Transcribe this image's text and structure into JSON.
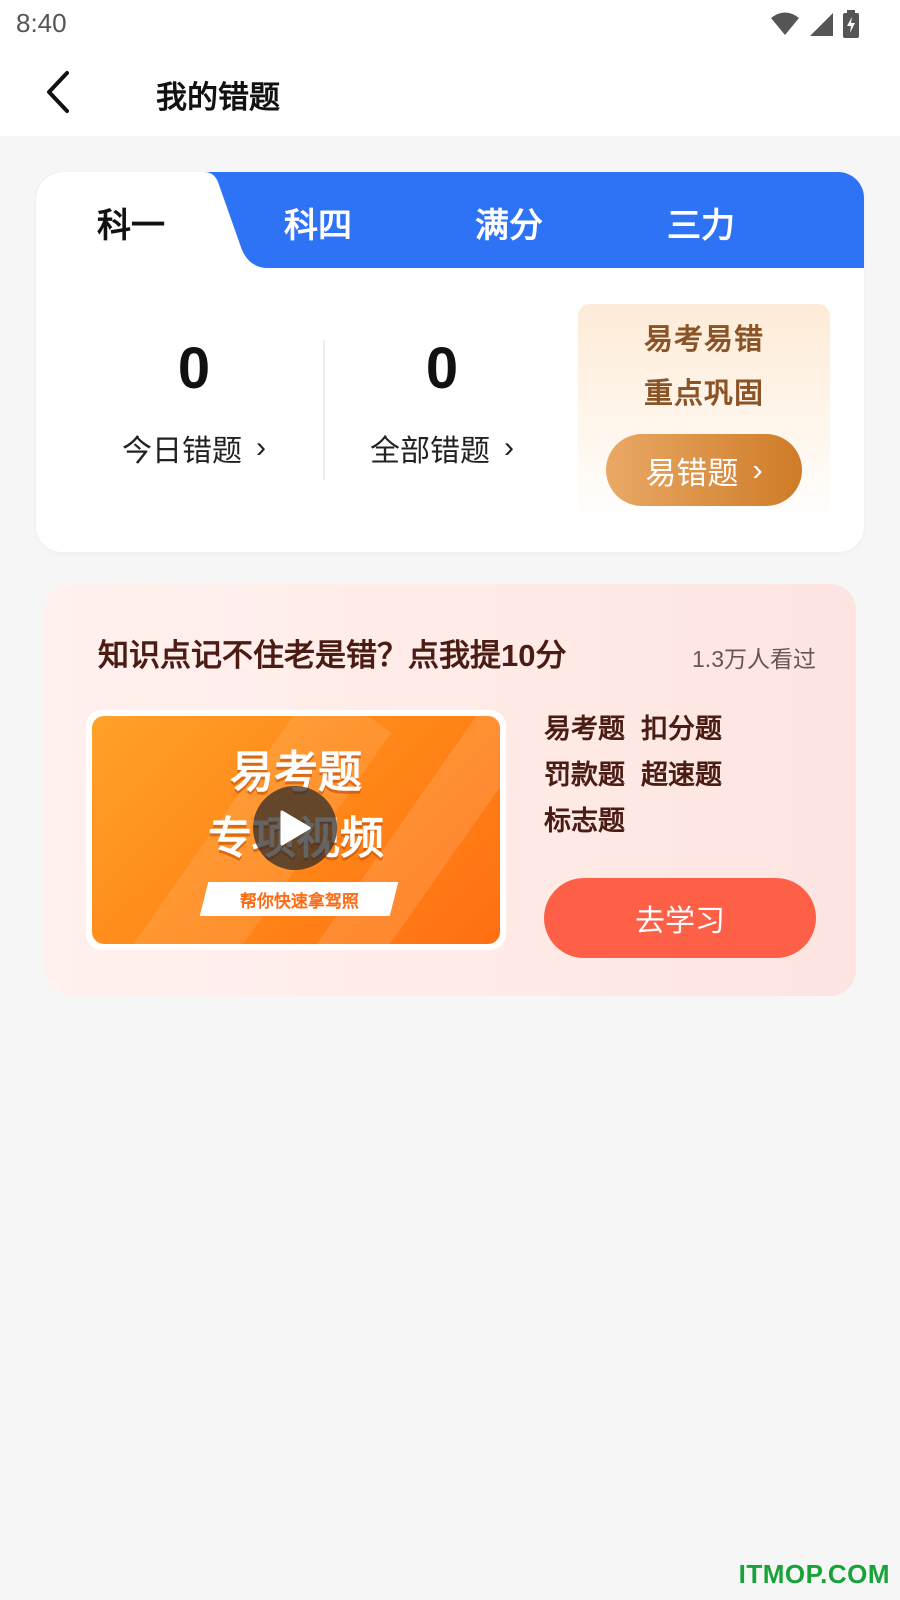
{
  "status_bar": {
    "time": "8:40",
    "icons": [
      "wifi-icon",
      "signal-icon",
      "battery-icon"
    ]
  },
  "nav": {
    "back_icon": "chevron-left-icon",
    "title": "我的错题"
  },
  "tabs": [
    {
      "label": "科一",
      "active": true
    },
    {
      "label": "科四",
      "active": false
    },
    {
      "label": "满分",
      "active": false
    },
    {
      "label": "三力",
      "active": false
    }
  ],
  "stats": {
    "today": {
      "value": "0",
      "label": "今日错题",
      "arrow": "›"
    },
    "all": {
      "value": "0",
      "label": "全部错题",
      "arrow": "›"
    }
  },
  "promo": {
    "line1": "易考易错",
    "line2": "重点巩固",
    "button_label": "易错题",
    "button_arrow": "›"
  },
  "study": {
    "title": "知识点记不住老是错？点我提10分",
    "views": "1.3万人看过",
    "video": {
      "line1": "易考题",
      "line2": "专项视频",
      "banner": "帮你快速拿驾照",
      "play_icon": "play-icon"
    },
    "tags": [
      [
        "易考题",
        "扣分题"
      ],
      [
        "罚款题",
        "超速题"
      ],
      [
        "标志题"
      ]
    ],
    "button_label": "去学习"
  },
  "watermark": "ITMOP.COM",
  "colors": {
    "tab_blue": "#2e72f6",
    "promo_text": "#8a5427",
    "promo_button_start": "#e9a966",
    "promo_button_end": "#cf7b27",
    "study_title": "#4a1c14",
    "study_button": "#fd5f47",
    "video_orange": "#ff8a19",
    "watermark_green": "#17a33a"
  }
}
